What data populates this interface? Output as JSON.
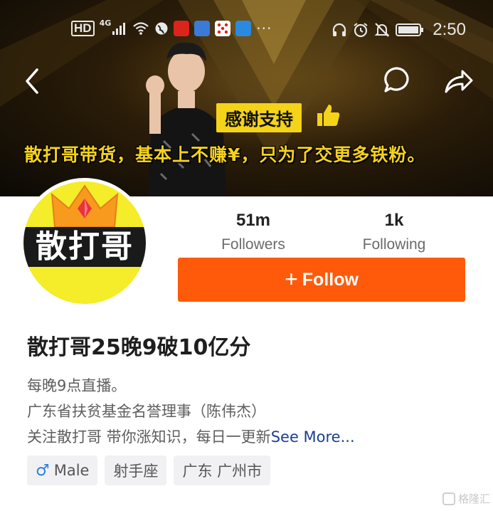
{
  "status_bar": {
    "hd": "HD",
    "network": "4G",
    "time": "2:50",
    "more_dots": "···",
    "icons": [
      "signal-icon",
      "wifi-icon",
      "vpn-icon",
      "app-icon",
      "headphones-icon",
      "alarm-icon",
      "mute-icon",
      "battery-icon"
    ]
  },
  "nav": {
    "back_icon": "chevron-left-icon",
    "comment_icon": "speech-bubble-icon",
    "share_icon": "share-arrow-icon"
  },
  "banner": {
    "thanks_text": "感谢支持",
    "slogan": "散打哥带货，基本上不赚¥，只为了交更多铁粉。"
  },
  "profile": {
    "avatar_text": "散打哥",
    "display_name": "散打哥25晚9破10亿分",
    "stats": {
      "followers_value": "51m",
      "followers_label": "Followers",
      "following_value": "1k",
      "following_label": "Following"
    },
    "follow_button": {
      "plus": "+",
      "label": "Follow"
    },
    "bio_lines": [
      "每晚9点直播。",
      "广东省扶贫基金名誉理事（陈伟杰）",
      "关注散打哥  带你涨知识，每日一更新"
    ],
    "see_more": "See More...",
    "tags": {
      "gender_icon": "♂",
      "gender": "Male",
      "zodiac": "射手座",
      "location": "广东 广州市"
    }
  },
  "colors": {
    "accent": "#ff5a0a",
    "link": "#1c3f8e",
    "banner_text": "#f6d21c"
  },
  "watermark": "格隆汇"
}
